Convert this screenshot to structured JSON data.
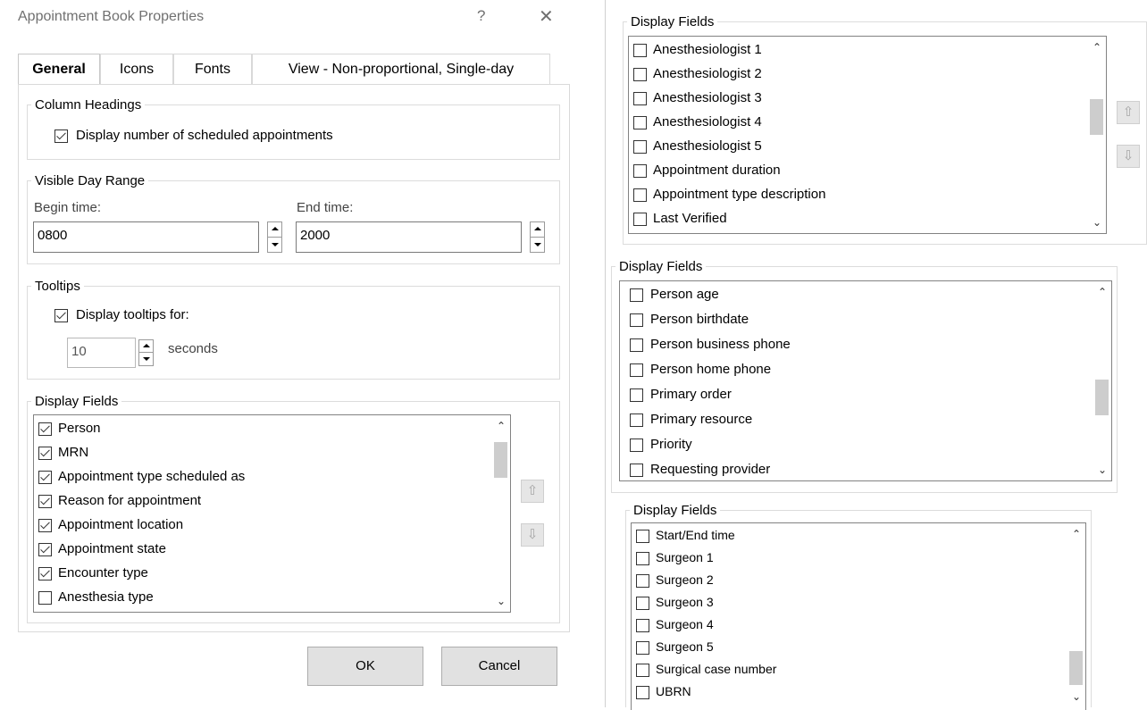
{
  "dialog": {
    "title": "Appointment Book Properties",
    "help_glyph": "?",
    "close_glyph": "✕"
  },
  "tabs": [
    "General",
    "Icons",
    "Fonts",
    "View - Non-proportional, Single-day"
  ],
  "active_tab": "General",
  "column_headings": {
    "legend": "Column Headings",
    "display_count_label": "Display number of scheduled appointments",
    "display_count_checked": true
  },
  "visible_day_range": {
    "legend": "Visible Day Range",
    "begin_label": "Begin time:",
    "begin_value": "0800",
    "end_label": "End time:",
    "end_value": "2000"
  },
  "tooltips": {
    "legend": "Tooltips",
    "display_label": "Display tooltips for:",
    "display_checked": true,
    "seconds_value": "10",
    "seconds_label": "seconds"
  },
  "display_fields_main": {
    "legend": "Display Fields",
    "items": [
      {
        "label": "Person",
        "checked": true
      },
      {
        "label": "MRN",
        "checked": true
      },
      {
        "label": "Appointment type scheduled as",
        "checked": true
      },
      {
        "label": "Reason for appointment",
        "checked": true
      },
      {
        "label": "Appointment location",
        "checked": true
      },
      {
        "label": "Appointment state",
        "checked": true
      },
      {
        "label": "Encounter type",
        "checked": true
      },
      {
        "label": "Anesthesia type",
        "checked": false
      }
    ]
  },
  "buttons": {
    "ok": "OK",
    "cancel": "Cancel"
  },
  "display_fields_panel_1": {
    "legend": "Display Fields",
    "items": [
      {
        "label": "Anesthesiologist 1",
        "checked": false
      },
      {
        "label": "Anesthesiologist 2",
        "checked": false
      },
      {
        "label": "Anesthesiologist 3",
        "checked": false
      },
      {
        "label": "Anesthesiologist 4",
        "checked": false
      },
      {
        "label": "Anesthesiologist 5",
        "checked": false
      },
      {
        "label": "Appointment duration",
        "checked": false
      },
      {
        "label": "Appointment type description",
        "checked": false
      },
      {
        "label": "Last Verified",
        "checked": false
      }
    ]
  },
  "display_fields_panel_2": {
    "legend": "Display Fields",
    "items": [
      {
        "label": "Person age",
        "checked": false
      },
      {
        "label": "Person birthdate",
        "checked": false
      },
      {
        "label": "Person business phone",
        "checked": false
      },
      {
        "label": "Person home phone",
        "checked": false
      },
      {
        "label": "Primary order",
        "checked": false
      },
      {
        "label": "Primary resource",
        "checked": false
      },
      {
        "label": "Priority",
        "checked": false
      },
      {
        "label": "Requesting provider",
        "checked": false
      }
    ]
  },
  "display_fields_panel_3": {
    "legend": "Display Fields",
    "items": [
      {
        "label": "Start/End time",
        "checked": false
      },
      {
        "label": "Surgeon 1",
        "checked": false
      },
      {
        "label": "Surgeon 2",
        "checked": false
      },
      {
        "label": "Surgeon 3",
        "checked": false
      },
      {
        "label": "Surgeon 4",
        "checked": false
      },
      {
        "label": "Surgeon 5",
        "checked": false
      },
      {
        "label": "Surgical case number",
        "checked": false
      },
      {
        "label": "UBRN",
        "checked": false
      }
    ]
  },
  "icons": {
    "scroll_up": "⌃",
    "scroll_down": "⌄",
    "move_up": "⇧",
    "move_down": "⇩"
  }
}
